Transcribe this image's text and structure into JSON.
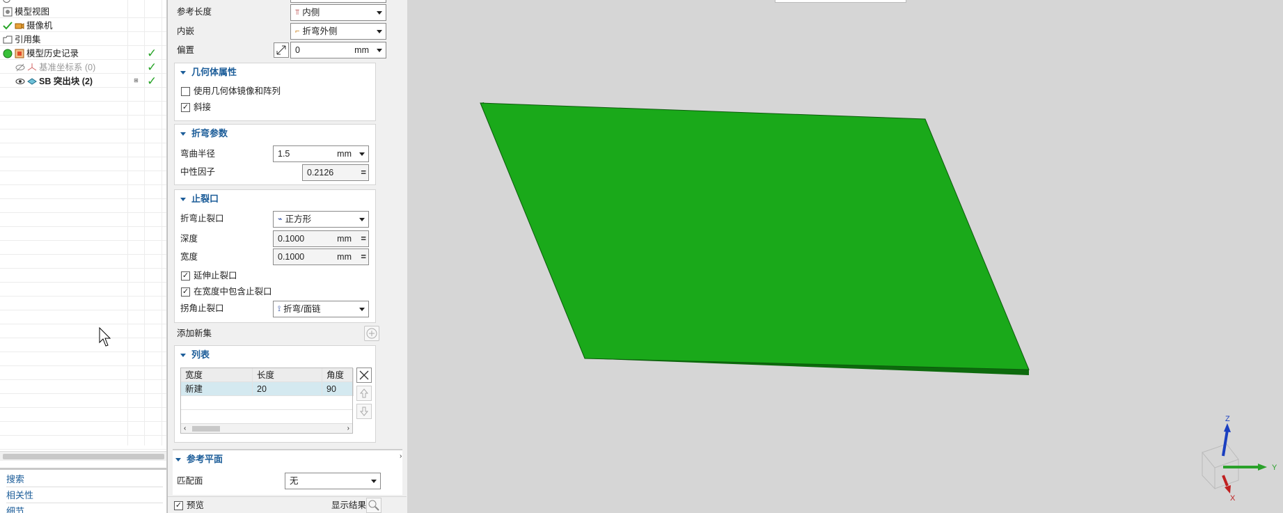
{
  "navigator": {
    "items": [
      {
        "label": "模型视图"
      },
      {
        "label": "摄像机"
      },
      {
        "label": "引用集"
      },
      {
        "label": "模型历史记录"
      },
      {
        "label": "基准坐标系 (0)"
      },
      {
        "label": "SB 突出块 (2)"
      }
    ],
    "links": [
      "搜索",
      "相关性",
      "细节"
    ]
  },
  "dialog": {
    "ref_length": {
      "label": "参考长度",
      "value": "内侧"
    },
    "inset": {
      "label": "内嵌",
      "value": "折弯外侧"
    },
    "offset": {
      "label": "偏置",
      "value": "0",
      "unit": "mm"
    },
    "geometry": {
      "title": "几何体属性",
      "mirror_label": "使用几何体镜像和阵列",
      "miter_label": "斜接"
    },
    "bend_params": {
      "title": "折弯参数",
      "radius_label": "弯曲半径",
      "radius_value": "1.5",
      "radius_unit": "mm",
      "kfactor_label": "中性因子",
      "kfactor_value": "0.2126"
    },
    "relief": {
      "title": "止裂口",
      "bend_relief_label": "折弯止裂口",
      "bend_relief_value": "正方形",
      "depth_label": "深度",
      "depth_value": "0.1000",
      "depth_unit": "mm",
      "width_label": "宽度",
      "width_value": "0.1000",
      "width_unit": "mm",
      "extend_label": "延伸止裂口",
      "include_label": "在宽度中包含止裂口",
      "corner_label": "拐角止裂口",
      "corner_value": "折弯/面链"
    },
    "add_set_label": "添加新集",
    "list": {
      "title": "列表",
      "headers": [
        "宽度",
        "长度",
        "角度"
      ],
      "rows": [
        [
          "新建",
          "20",
          "90"
        ]
      ]
    },
    "ref_plane": {
      "title": "参考平面",
      "match_label": "匹配面",
      "match_value": "无"
    },
    "preview_label": "预览",
    "show_result_label": "显示结果"
  },
  "triad": {
    "z": "Z",
    "y": "Y",
    "x": "X"
  },
  "colors": {
    "plate": "#1aa91a",
    "plate_edge": "#0d6a0d",
    "accent": "#1c5d99",
    "check": "#28a428"
  }
}
